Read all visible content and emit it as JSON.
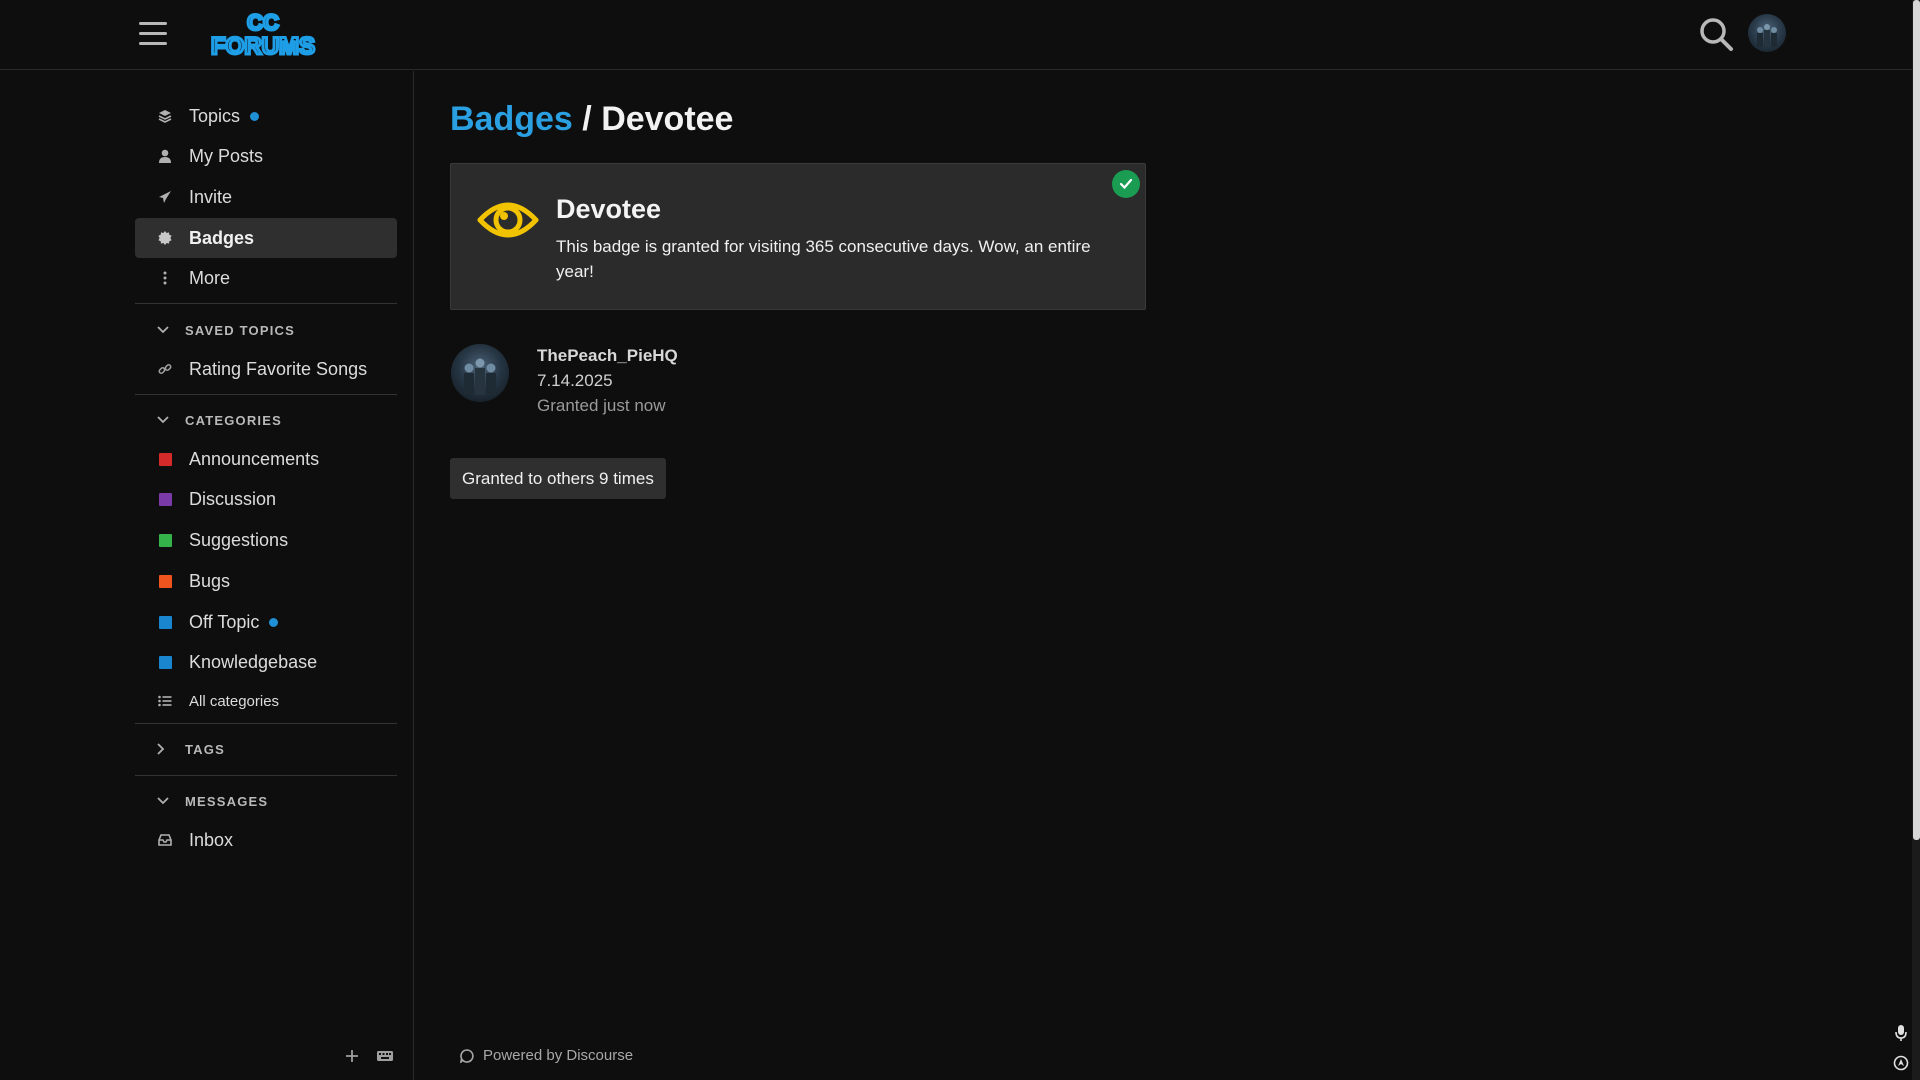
{
  "header": {
    "logo_text_top": "CC",
    "logo_text_bottom": "FORUMS",
    "brand_color": "#1f9ee8"
  },
  "sidebar": {
    "main_items": [
      {
        "label": "Topics",
        "icon": "layers-icon",
        "has_dot": true
      },
      {
        "label": "My Posts",
        "icon": "user-icon"
      },
      {
        "label": "Invite",
        "icon": "paper-plane-icon"
      },
      {
        "label": "Badges",
        "icon": "certificate-icon",
        "active": true
      },
      {
        "label": "More",
        "icon": "ellipsis-vertical-icon"
      }
    ],
    "saved_topics": {
      "header": "SAVED TOPICS",
      "items": [
        {
          "label": "Rating Favorite Songs",
          "icon": "link-icon"
        }
      ]
    },
    "categories": {
      "header": "CATEGORIES",
      "items": [
        {
          "label": "Announcements",
          "color": "#d42a2a"
        },
        {
          "label": "Discussion",
          "color": "#7a3ba8"
        },
        {
          "label": "Suggestions",
          "color": "#33b34a"
        },
        {
          "label": "Bugs",
          "color": "#f0541e"
        },
        {
          "label": "Off Topic",
          "color": "#1a86d0",
          "has_dot": true
        },
        {
          "label": "Knowledgebase",
          "color": "#1a86d0"
        }
      ],
      "all_label": "All categories"
    },
    "tags": {
      "header": "TAGS"
    },
    "messages": {
      "header": "MESSAGES",
      "items": [
        {
          "label": "Inbox",
          "icon": "inbox-icon"
        }
      ]
    }
  },
  "main": {
    "breadcrumb_link": "Badges",
    "breadcrumb_sep": "/",
    "breadcrumb_current": "Devotee",
    "badge": {
      "name": "Devotee",
      "description": "This badge is granted for visiting 365 consecutive days. Wow, an entire year!",
      "icon": "eye-icon",
      "icon_color": "#f2c300",
      "granted_color": "#1a9c53"
    },
    "grant": {
      "username": "ThePeach_PieHQ",
      "date": "7.14.2025",
      "granted_text": "Granted just now"
    },
    "others_button": "Granted to others 9 times",
    "footer": "Powered by Discourse"
  }
}
